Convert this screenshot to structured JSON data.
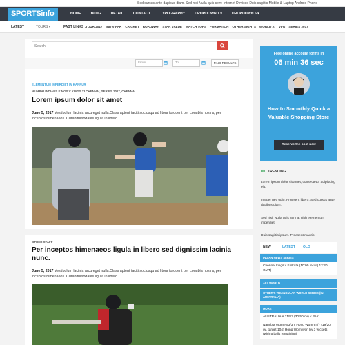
{
  "ticker": "Sed cursus ante dapibus diam. Sed nisi Nulla quis sem: Internet Devices  Duis sagittis  Mobile & Laptop  Android Phone",
  "brand": {
    "logo": "SPORTSinfo",
    "accent": "#3ca3dc",
    "topbar_bg": "#363b44"
  },
  "nav": [
    "HOME",
    "BLOG",
    "DETAIL",
    "CONTACT",
    "TYPOGRAPHY",
    "DROPDOWN 1 ▾",
    "DROPDOWN 5 ▾"
  ],
  "subnav": {
    "latest": "LATEST",
    "tours": "TOURS ▾",
    "fast_links_label": "FAST LINKS :",
    "links": [
      "TOUR 2017",
      "IND V PAK",
      "CRICKET",
      "ROADWAY",
      "STAR VALUE",
      "MATCH TOPS",
      "FORMATION",
      "OTHER SIGHTS",
      "WORLD XI",
      "VFG",
      "SERIES 2017"
    ]
  },
  "search": {
    "placeholder": "Search",
    "icon": "search-icon"
  },
  "filter": {
    "from_placeholder": "From",
    "to_placeholder": "To",
    "find_label": "FIND RESULTS",
    "icon": "calendar-icon"
  },
  "posts": [
    {
      "category": "ELEMENTUM IMPERDIET IN KANPUR",
      "tags": "MUMBAI INDIANS KINGS V KINGS XI CHENNAI, SERIES 2017, CHENNAI",
      "title": "Lorem ipsum dolor sit amet",
      "date": "June 5, 2017",
      "excerpt": "Vestibulum lacinia arcu eget nulla.Class aptent taciti sociosqu ad litora torquent per conubia nostra, per inceptos himenaeos. Curabitursodales ligula in libero."
    },
    {
      "category": "OTHER STAFF",
      "title": "Per inceptos himenaeos ligula in libero sed dignissim lacinia nunc.",
      "date": "June 5, 2017",
      "excerpt": "Vestibulum lacinia arcu eget nulla.Class aptent taciti sociosqu ad litora torquent per conubia nostra, per inceptos himenaeos. Curabitursodales ligula in libero."
    }
  ],
  "ad": {
    "line1": "Free online account forms in",
    "countdown": "06 min 36 sec",
    "headline": "How to Smoothly Quick a Valuable Shopping Store",
    "button": "Reserve the post now"
  },
  "trending": {
    "badge": "TM",
    "label": "TRENDING",
    "items": [
      "Lorem ipsum dolor sit amet, consectetur adipiscing elit.",
      "Integer nec odio. Praesent libero. Sed cursus ante dapibus diam.",
      "Sed nisi. Nulla quis sem at nibh elementum imperdiet.",
      "Duis sagittis ipsum. Praesent mauris."
    ]
  },
  "tabs": [
    "NEW",
    "LATEST",
    "OLD"
  ],
  "series": [
    {
      "head": "INDIAN NEWS SERIES",
      "item": "Chennai kings v Kolkata (10:00 local | 12:30 GMT)"
    },
    {
      "head": "ALL WORLD",
      "item": ""
    },
    {
      "head": "OTHER'S TRIANGULAR WORLD SERIES (IN AUSTRALIA)",
      "item": ""
    },
    {
      "head": "MORE",
      "item": "AUSTRALIA A 219/3 (30/50 ov) v PAK"
    },
    {
      "head": "",
      "item": "Namibia Wome 53/3 v Hong Wom 94/7 (19/20 ov, target 104) Hong Wom won by 3 wickets (with 5 balls remaining)"
    }
  ]
}
